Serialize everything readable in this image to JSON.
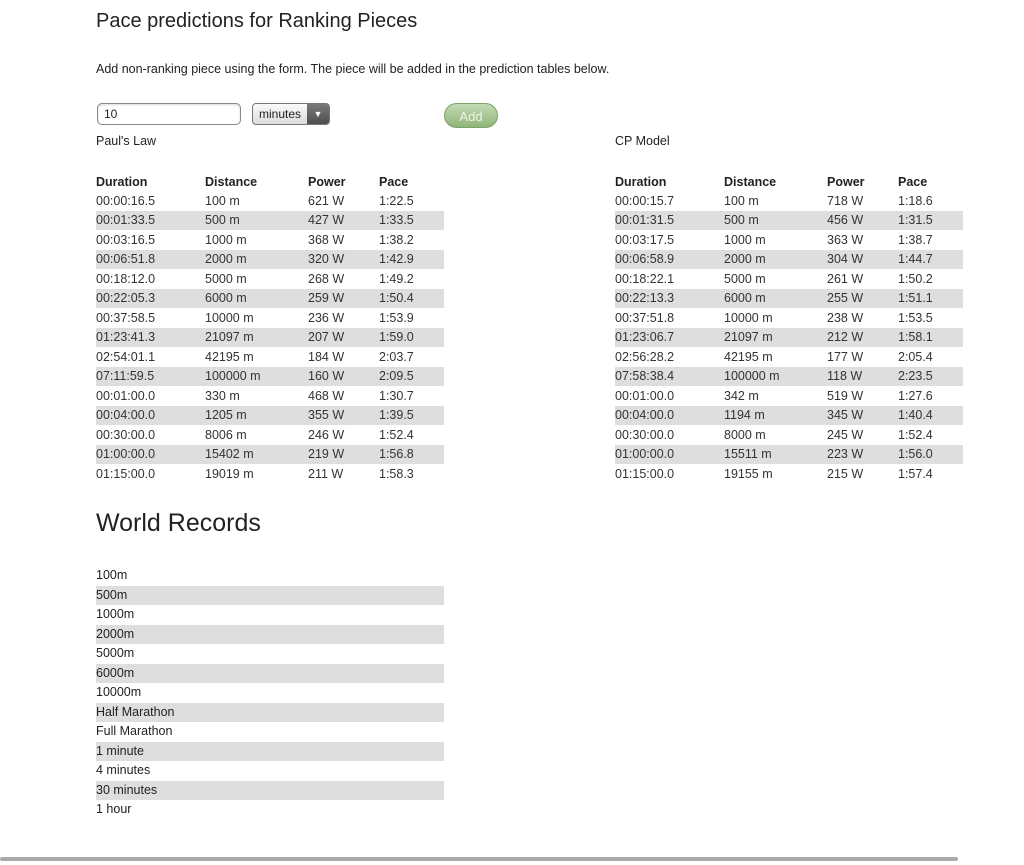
{
  "page": {
    "title": "Pace predictions for Ranking Pieces",
    "intro": "Add non-ranking piece using the form. The piece will be added in the prediction tables below."
  },
  "form": {
    "duration_value": "10",
    "unit_selected": "minutes",
    "unit_arrow_icon": "triangle-down",
    "add_label": "Add"
  },
  "pauls_law": {
    "title": "Paul's Law",
    "headers": [
      "Duration",
      "Distance",
      "Power",
      "Pace"
    ],
    "rows": [
      [
        "00:00:16.5",
        "100 m",
        "621 W",
        "1:22.5"
      ],
      [
        "00:01:33.5",
        "500 m",
        "427 W",
        "1:33.5"
      ],
      [
        "00:03:16.5",
        "1000 m",
        "368 W",
        "1:38.2"
      ],
      [
        "00:06:51.8",
        "2000 m",
        "320 W",
        "1:42.9"
      ],
      [
        "00:18:12.0",
        "5000 m",
        "268 W",
        "1:49.2"
      ],
      [
        "00:22:05.3",
        "6000 m",
        "259 W",
        "1:50.4"
      ],
      [
        "00:37:58.5",
        "10000 m",
        "236 W",
        "1:53.9"
      ],
      [
        "01:23:41.3",
        "21097 m",
        "207 W",
        "1:59.0"
      ],
      [
        "02:54:01.1",
        "42195 m",
        "184 W",
        "2:03.7"
      ],
      [
        "07:11:59.5",
        "100000 m",
        "160 W",
        "2:09.5"
      ],
      [
        "00:01:00.0",
        "330 m",
        "468 W",
        "1:30.7"
      ],
      [
        "00:04:00.0",
        "1205 m",
        "355 W",
        "1:39.5"
      ],
      [
        "00:30:00.0",
        "8006 m",
        "246 W",
        "1:52.4"
      ],
      [
        "01:00:00.0",
        "15402 m",
        "219 W",
        "1:56.8"
      ],
      [
        "01:15:00.0",
        "19019 m",
        "211 W",
        "1:58.3"
      ]
    ]
  },
  "cp_model": {
    "title": "CP Model",
    "headers": [
      "Duration",
      "Distance",
      "Power",
      "Pace"
    ],
    "rows": [
      [
        "00:00:15.7",
        "100 m",
        "718 W",
        "1:18.6"
      ],
      [
        "00:01:31.5",
        "500 m",
        "456 W",
        "1:31.5"
      ],
      [
        "00:03:17.5",
        "1000 m",
        "363 W",
        "1:38.7"
      ],
      [
        "00:06:58.9",
        "2000 m",
        "304 W",
        "1:44.7"
      ],
      [
        "00:18:22.1",
        "5000 m",
        "261 W",
        "1:50.2"
      ],
      [
        "00:22:13.3",
        "6000 m",
        "255 W",
        "1:51.1"
      ],
      [
        "00:37:51.8",
        "10000 m",
        "238 W",
        "1:53.5"
      ],
      [
        "01:23:06.7",
        "21097 m",
        "212 W",
        "1:58.1"
      ],
      [
        "02:56:28.2",
        "42195 m",
        "177 W",
        "2:05.4"
      ],
      [
        "07:58:38.4",
        "100000 m",
        "118 W",
        "2:23.5"
      ],
      [
        "00:01:00.0",
        "342 m",
        "519 W",
        "1:27.6"
      ],
      [
        "00:04:00.0",
        "1194 m",
        "345 W",
        "1:40.4"
      ],
      [
        "00:30:00.0",
        "8000 m",
        "245 W",
        "1:52.4"
      ],
      [
        "01:00:00.0",
        "15511 m",
        "223 W",
        "1:56.0"
      ],
      [
        "01:15:00.0",
        "19155 m",
        "215 W",
        "1:57.4"
      ]
    ]
  },
  "world_records": {
    "title": "World Records",
    "items": [
      "100m",
      "500m",
      "1000m",
      "2000m",
      "5000m",
      "6000m",
      "10000m",
      "Half Marathon",
      "Full Marathon",
      "1 minute",
      "4 minutes",
      "30 minutes",
      "1 hour"
    ]
  }
}
